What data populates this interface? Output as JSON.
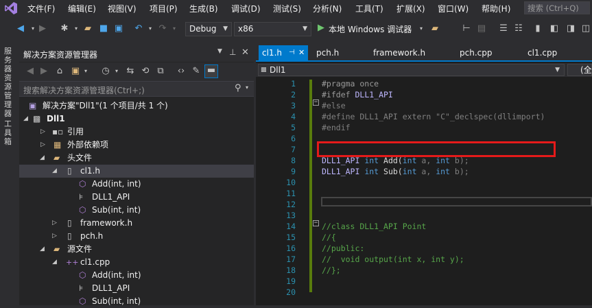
{
  "menu": {
    "items": [
      "文件(F)",
      "编辑(E)",
      "视图(V)",
      "项目(P)",
      "生成(B)",
      "调试(D)",
      "测试(S)",
      "分析(N)",
      "工具(T)",
      "扩展(X)",
      "窗口(W)",
      "帮助(H)"
    ],
    "search_placeholder": "搜索 (Ctrl+Q)"
  },
  "toolbar": {
    "config": "Debug",
    "platform": "x86",
    "run_label": "本地 Windows 调试器",
    "icons": [
      "back-icon",
      "forward-icon",
      "new-project-icon",
      "open-icon",
      "save-icon",
      "save-all-icon",
      "undo-icon",
      "redo-icon",
      "run-icon",
      "bookmark-icon"
    ]
  },
  "left_strip": {
    "tabs": [
      "服务器资源管理器",
      "工具箱"
    ]
  },
  "solution_explorer": {
    "title": "解决方案资源管理器",
    "search_placeholder": "搜索解决方案资源管理器(Ctrl+;)",
    "tree": [
      {
        "label": "解决方案\"Dll1\"(1 个项目/共 1 个)",
        "icon": "solution-icon",
        "level": 0,
        "expander": ""
      },
      {
        "label": "Dll1",
        "icon": "project-icon",
        "level": 0,
        "expander": "expanded",
        "bold": true
      },
      {
        "label": "引用",
        "icon": "references-icon",
        "level": 1,
        "expander": "collapsed"
      },
      {
        "label": "外部依赖项",
        "icon": "external-deps-icon",
        "level": 1,
        "expander": "collapsed"
      },
      {
        "label": "头文件",
        "icon": "folder-icon",
        "level": 1,
        "expander": "expanded"
      },
      {
        "label": "cl1.h",
        "icon": "header-file-icon",
        "level": 2,
        "expander": "expanded",
        "selected": true
      },
      {
        "label": "Add(int, int)",
        "icon": "function-icon",
        "level": 3,
        "expander": ""
      },
      {
        "label": "DLL1_API",
        "icon": "macro-icon",
        "level": 3,
        "expander": ""
      },
      {
        "label": "Sub(int, int)",
        "icon": "function-icon",
        "level": 3,
        "expander": ""
      },
      {
        "label": "framework.h",
        "icon": "header-file-icon",
        "level": 2,
        "expander": "collapsed"
      },
      {
        "label": "pch.h",
        "icon": "header-file-icon",
        "level": 2,
        "expander": "collapsed"
      },
      {
        "label": "源文件",
        "icon": "folder-icon",
        "level": 1,
        "expander": "expanded"
      },
      {
        "label": "cl1.cpp",
        "icon": "cpp-file-icon",
        "level": 2,
        "expander": "expanded"
      },
      {
        "label": "Add(int, int)",
        "icon": "function-icon",
        "level": 3,
        "expander": ""
      },
      {
        "label": "DLL1_API",
        "icon": "macro-icon",
        "level": 3,
        "expander": ""
      },
      {
        "label": "Sub(int, int)",
        "icon": "function-icon",
        "level": 3,
        "expander": ""
      }
    ]
  },
  "editor": {
    "tabs": [
      {
        "label": "cl1.h",
        "active": true
      },
      {
        "label": "pch.h",
        "active": false
      },
      {
        "label": "framework.h",
        "active": false
      },
      {
        "label": "pch.cpp",
        "active": false
      },
      {
        "label": "cl1.cpp",
        "active": false
      }
    ],
    "scope": "Dll1",
    "scope2": "(全",
    "line_numbers": [
      "1",
      "2",
      "3",
      "4",
      "5",
      "6",
      "7",
      "8",
      "9",
      "10",
      "11",
      "12",
      "13",
      "14",
      "15",
      "16",
      "17",
      "18",
      "19",
      "20"
    ],
    "lines": {
      "l1": "#pragma once",
      "l2a": "#ifdef ",
      "l2b": "DLL1_API",
      "l3": "#else",
      "l4a": "#define DLL1_API ",
      "l4b": "extern ",
      "l4c": "\"C\"",
      "l4d": "_declspec(dllimport)",
      "l5": "#endif",
      "l8a": "DLL1_API ",
      "l8b": "int",
      "l8c": " Add(",
      "l8d": "int",
      "l8e": " a, ",
      "l8f": "int",
      "l8g": " b);",
      "l9a": "DLL1_API ",
      "l9b": "int",
      "l9c": " Sub(",
      "l9d": "int",
      "l9e": " a, ",
      "l9f": "int",
      "l9g": " b);",
      "l14": "//class DLL1_API Point",
      "l15": "//{",
      "l16": "//public:",
      "l17": "//  void output(int x, int y);",
      "l18": "//};"
    },
    "annotation_color": "#e51a1a"
  }
}
